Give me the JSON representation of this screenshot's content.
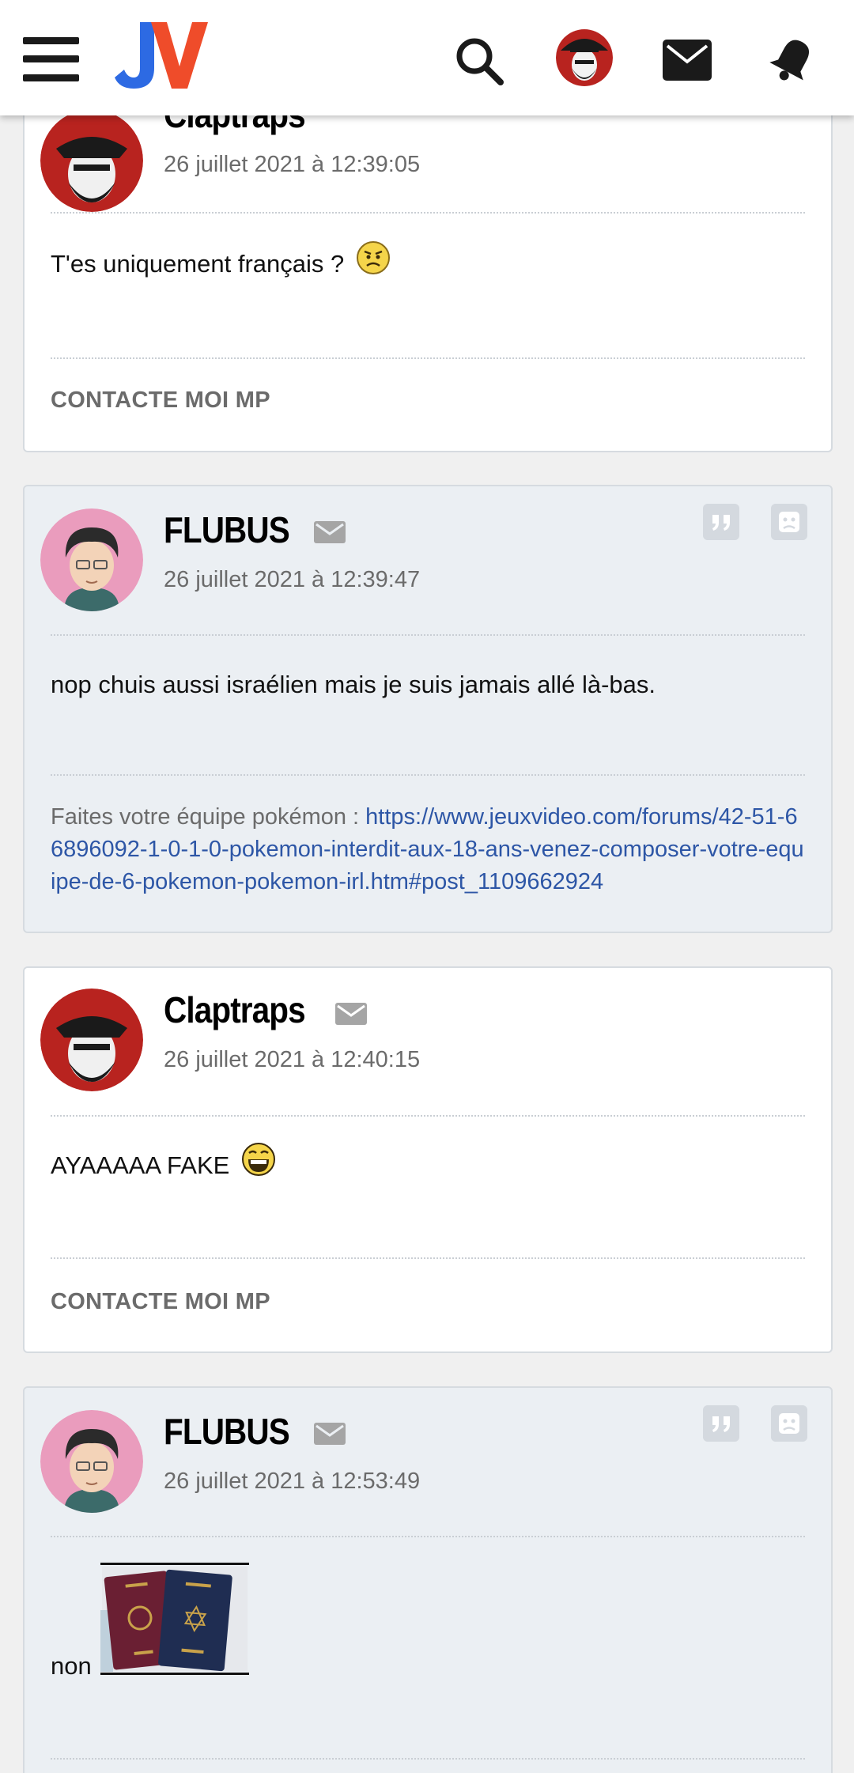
{
  "header": {
    "logo_text": "JV",
    "colors": {
      "logo_j": "#2d6ae3",
      "logo_v": "#ef4c2a",
      "icons": "#1a1a1a"
    }
  },
  "posts": [
    {
      "author": "Claptraps",
      "date": "26 juillet 2021 à 12:39:05",
      "message": "T'es uniquement français ?",
      "emoji": "doubt-smiley",
      "signature": "CONTACTE MOI MP"
    },
    {
      "author": "FLUBUS",
      "date": "26 juillet 2021 à 12:39:47",
      "message": "nop chuis aussi israélien mais je suis jamais allé là-bas.",
      "signature_prefix": "Faites votre équipe pokémon : ",
      "signature_link": "https://www.jeuxvideo.com/forums/42-51-66896092-1-0-1-0-pokemon-interdit-aux-18-ans-venez-composer-votre-equipe-de-6-pokemon-pokemon-irl.htm#post_1109662924"
    },
    {
      "author": "Claptraps",
      "date": "26 juillet 2021 à 12:40:15",
      "message": "AYAAAAA FAKE",
      "emoji": "laughing-smiley",
      "signature": "CONTACTE MOI MP"
    },
    {
      "author": "FLUBUS",
      "date": "26 juillet 2021 à 12:53:49",
      "message": "non",
      "image": "passports-photo"
    }
  ]
}
